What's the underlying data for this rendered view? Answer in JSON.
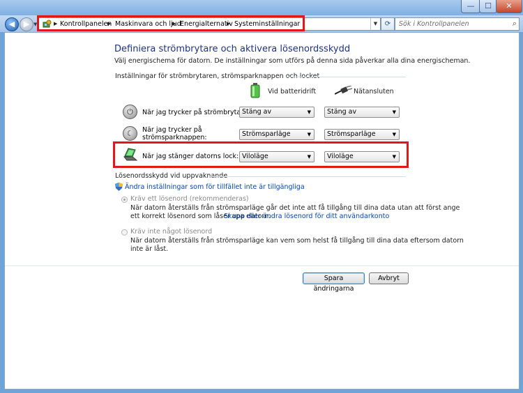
{
  "window": {
    "minimize_glyph": "—",
    "maximize_glyph": "☐",
    "close_glyph": "✕"
  },
  "nav": {
    "back_glyph": "◀",
    "forward_glyph": "▶"
  },
  "breadcrumbs": [
    "Kontrollpanelen",
    "Maskinvara och ljud",
    "Energialternativ",
    "Systeminställningar"
  ],
  "search": {
    "placeholder": "Sök i Kontrollpanelen"
  },
  "page": {
    "title": "Definiera strömbrytare och aktivera lösenordsskydd",
    "description": "Välj energischema för datorn. De inställningar som utförs på denna sida påverkar alla dina energischeman.",
    "power_section_title": "Inställningar för strömbrytaren, strömsparknappen och locket",
    "columns": {
      "battery": "Vid batteridrift",
      "plugged": "Nätansluten"
    },
    "rows": [
      {
        "label": "När jag trycker på strömbrytaren:",
        "battery": "Stäng av",
        "plugged": "Stäng av"
      },
      {
        "label": "När jag trycker på strömsparknappen:",
        "battery": "Strömsparläge",
        "plugged": "Strömsparläge"
      },
      {
        "label": "När jag stänger datorns lock:",
        "battery": "Viloläge",
        "plugged": "Viloläge"
      }
    ],
    "password_section_title": "Lösenordsskydd vid uppvaknande",
    "change_settings_link": "Ändra inställningar som för tillfället inte är tillgängliga",
    "require_password": {
      "label": "Kräv ett lösenord (rekommenderas)",
      "desc_line1": "När datorn återställs från strömsparläge går det inte att få tillgång till dina data utan att först ange",
      "desc_line2_pre": "ett korrekt lösenord som låser upp datorn.",
      "desc_link": "Skapa eller ändra lösenord för ditt användarkonto"
    },
    "no_password": {
      "label": "Kräv inte något lösenord",
      "desc_line1": "När datorn återställs från strömsparläge kan vem som helst få tillgång till dina data eftersom datorn",
      "desc_line2": "inte är låst."
    },
    "buttons": {
      "save": "Spara ändringarna",
      "cancel": "Avbryt"
    }
  },
  "colors": {
    "highlight": "#e01818",
    "heading": "#1e3287",
    "link": "#0645ad"
  }
}
